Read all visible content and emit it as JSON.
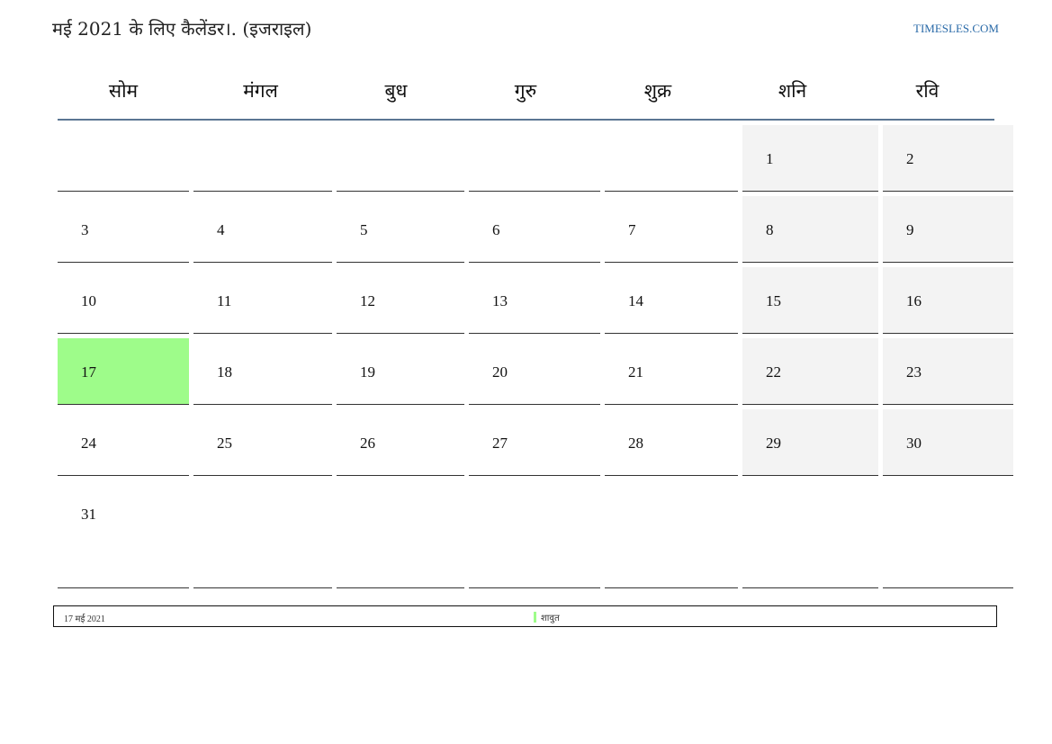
{
  "header": {
    "title": "मई 2021 के लिए कैलेंडर।. (इजराइल)",
    "site": "TIMESLES.COM"
  },
  "weekdays": [
    "सोम",
    "मंगल",
    "बुध",
    "गुरु",
    "शुक्र",
    "शनि",
    "रवि"
  ],
  "weeks": [
    [
      "",
      "",
      "",
      "",
      "",
      "1",
      "2"
    ],
    [
      "3",
      "4",
      "5",
      "6",
      "7",
      "8",
      "9"
    ],
    [
      "10",
      "11",
      "12",
      "13",
      "14",
      "15",
      "16"
    ],
    [
      "17",
      "18",
      "19",
      "20",
      "21",
      "22",
      "23"
    ],
    [
      "24",
      "25",
      "26",
      "27",
      "28",
      "29",
      "30"
    ],
    [
      "31",
      "",
      "",
      "",
      "",
      "",
      ""
    ]
  ],
  "highlight": {
    "week": 3,
    "day": 0,
    "color": "#9efc8a"
  },
  "colors": {
    "weekend": "#f3f3f3",
    "accent_line": "#5b7693",
    "link": "#2a6aa8"
  },
  "legend": {
    "date": "17 मई 2021",
    "holiday": "शावुत"
  }
}
